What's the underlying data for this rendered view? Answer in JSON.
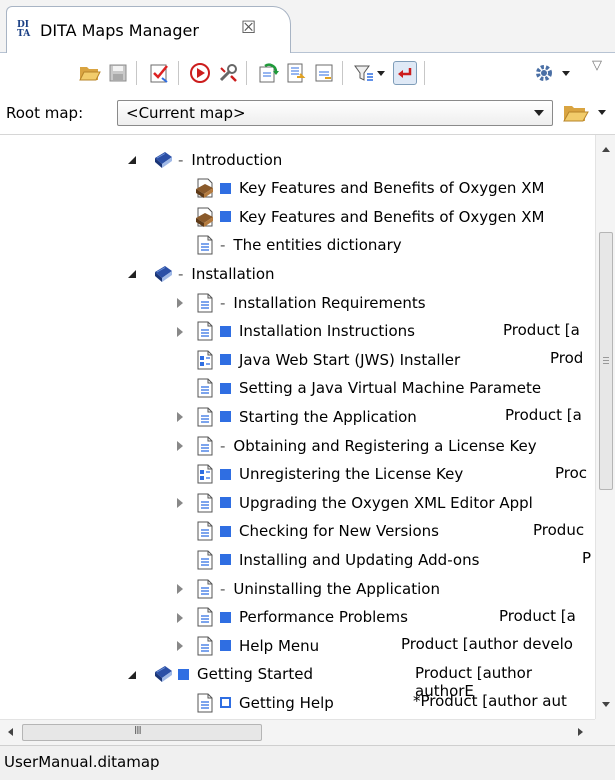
{
  "tab": {
    "title": "DITA Maps Manager",
    "close_glyph": "☒",
    "icon_text_top": "DI",
    "icon_text_bottom": "TA"
  },
  "root_map": {
    "label": "Root map:",
    "value": "<Current map>"
  },
  "tree_rows": [
    {
      "level": 0,
      "expander": "open",
      "icon": "map-icon",
      "status": "dash",
      "label": "Introduction",
      "condition": ""
    },
    {
      "level": 1,
      "expander": "none",
      "icon": "book-icon",
      "status": "square",
      "label": "Key Features and Benefits of Oxygen XM",
      "condition": ""
    },
    {
      "level": 1,
      "expander": "none",
      "icon": "book-icon",
      "status": "square",
      "label": "Key Features and Benefits of Oxygen XM",
      "condition": ""
    },
    {
      "level": 1,
      "expander": "none",
      "icon": "topic-icon",
      "status": "dash",
      "label": "The entities dictionary",
      "condition": ""
    },
    {
      "level": 0,
      "expander": "open",
      "icon": "map-icon",
      "status": "dash",
      "label": "Installation",
      "condition": ""
    },
    {
      "level": 1,
      "expander": "closed",
      "icon": "topic-icon",
      "status": "dash",
      "label": "Installation Requirements",
      "condition": ""
    },
    {
      "level": 1,
      "expander": "closed",
      "icon": "topic-icon",
      "status": "square",
      "label": "Installation Instructions",
      "condition": "Product [a"
    },
    {
      "level": 1,
      "expander": "none",
      "icon": "task-icon",
      "status": "square",
      "label": "Java Web Start (JWS) Installer",
      "condition": "Prod"
    },
    {
      "level": 1,
      "expander": "none",
      "icon": "topic-icon",
      "status": "square",
      "label": "Setting a Java Virtual Machine Paramete",
      "condition": ""
    },
    {
      "level": 1,
      "expander": "closed",
      "icon": "topic-icon",
      "status": "square",
      "label": "Starting the Application",
      "condition": "Product [a"
    },
    {
      "level": 1,
      "expander": "closed",
      "icon": "topic-icon",
      "status": "dash",
      "label": "Obtaining and Registering a License Key",
      "condition": ""
    },
    {
      "level": 1,
      "expander": "none",
      "icon": "task-icon",
      "status": "square",
      "label": "Unregistering the License Key",
      "condition": "Proc"
    },
    {
      "level": 1,
      "expander": "closed",
      "icon": "topic-icon",
      "status": "square",
      "label": "Upgrading the Oxygen XML Editor Appl",
      "condition": ""
    },
    {
      "level": 1,
      "expander": "none",
      "icon": "topic-icon",
      "status": "square",
      "label": "Checking for New Versions",
      "condition": "Produc"
    },
    {
      "level": 1,
      "expander": "none",
      "icon": "topic-icon",
      "status": "square",
      "label": "Installing and Updating Add-ons",
      "condition": "P"
    },
    {
      "level": 1,
      "expander": "closed",
      "icon": "topic-icon",
      "status": "dash",
      "label": "Uninstalling the Application",
      "condition": ""
    },
    {
      "level": 1,
      "expander": "closed",
      "icon": "topic-icon",
      "status": "square",
      "label": "Performance Problems",
      "condition": "Product [a"
    },
    {
      "level": 1,
      "expander": "closed",
      "icon": "topic-icon",
      "status": "square",
      "label": "Help Menu",
      "condition": "Product [author develo"
    },
    {
      "level": 0,
      "expander": "open",
      "icon": "map-icon",
      "status": "square",
      "label": "Getting Started",
      "condition": "Product [author authorE"
    },
    {
      "level": 1,
      "expander": "none",
      "icon": "topic-icon",
      "status": "hollow",
      "label": "Getting Help",
      "condition": "*Product [author aut"
    }
  ],
  "scrollbar": {
    "horizontal_grip": "III"
  },
  "status": {
    "text": "UserManual.ditamap"
  },
  "colors": {
    "accent": "#2f6ee2",
    "map_icon": "#2b4fa6"
  }
}
